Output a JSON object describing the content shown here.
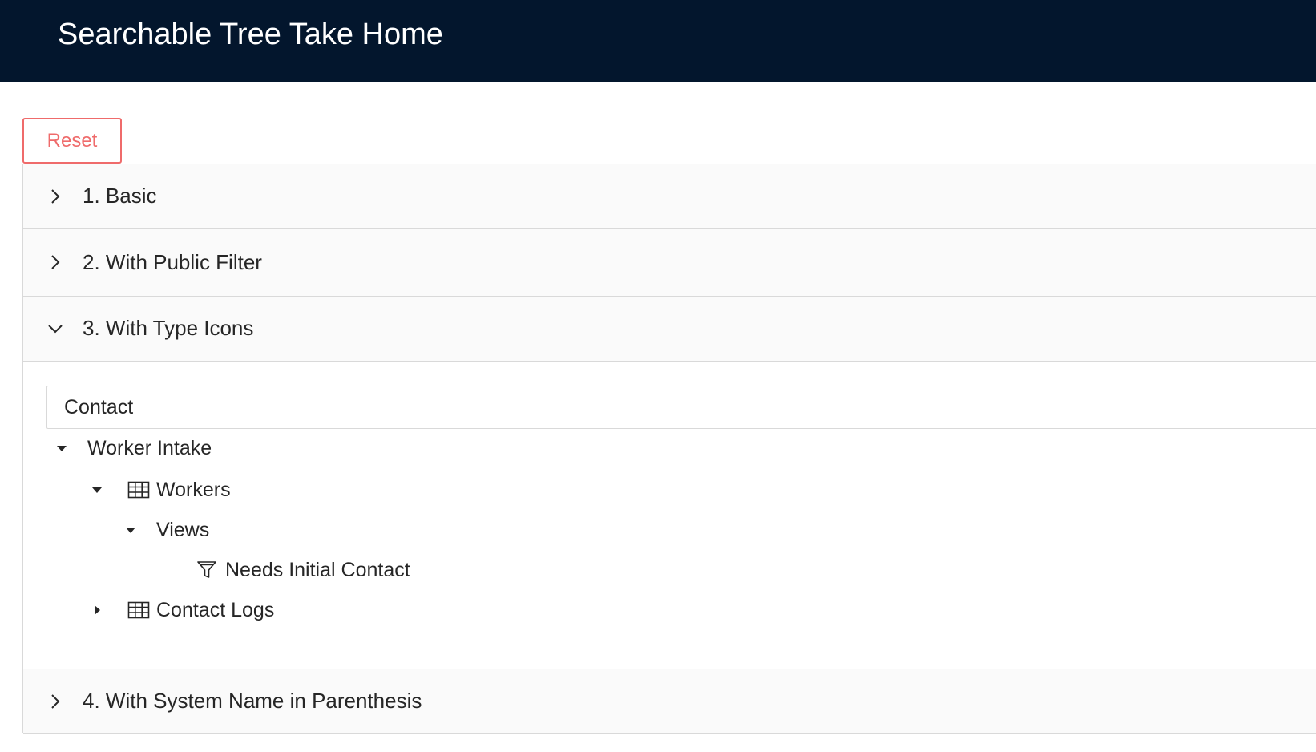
{
  "header": {
    "title": "Searchable Tree Take Home",
    "background": "#03162d"
  },
  "toolbar": {
    "reset_label": "Reset",
    "accent": "#ef6b6b"
  },
  "panels": [
    {
      "label": "1. Basic",
      "expanded": false
    },
    {
      "label": "2. With Public Filter",
      "expanded": false
    },
    {
      "label": "3. With Type Icons",
      "expanded": true
    },
    {
      "label": "4. With System Name in Parenthesis",
      "expanded": false
    }
  ],
  "type_icons_panel": {
    "search_value": "Contact",
    "tree": [
      {
        "label": "Worker Intake",
        "icon": null,
        "expanded": true,
        "depth": 0
      },
      {
        "label": "Workers",
        "icon": "table-icon",
        "expanded": true,
        "depth": 1
      },
      {
        "label": "Views",
        "icon": null,
        "expanded": true,
        "depth": 2
      },
      {
        "label": "Needs Initial Contact",
        "icon": "filter-icon",
        "expanded": null,
        "depth": 3
      },
      {
        "label": "Contact Logs",
        "icon": "table-icon",
        "expanded": false,
        "depth": 1
      }
    ]
  }
}
